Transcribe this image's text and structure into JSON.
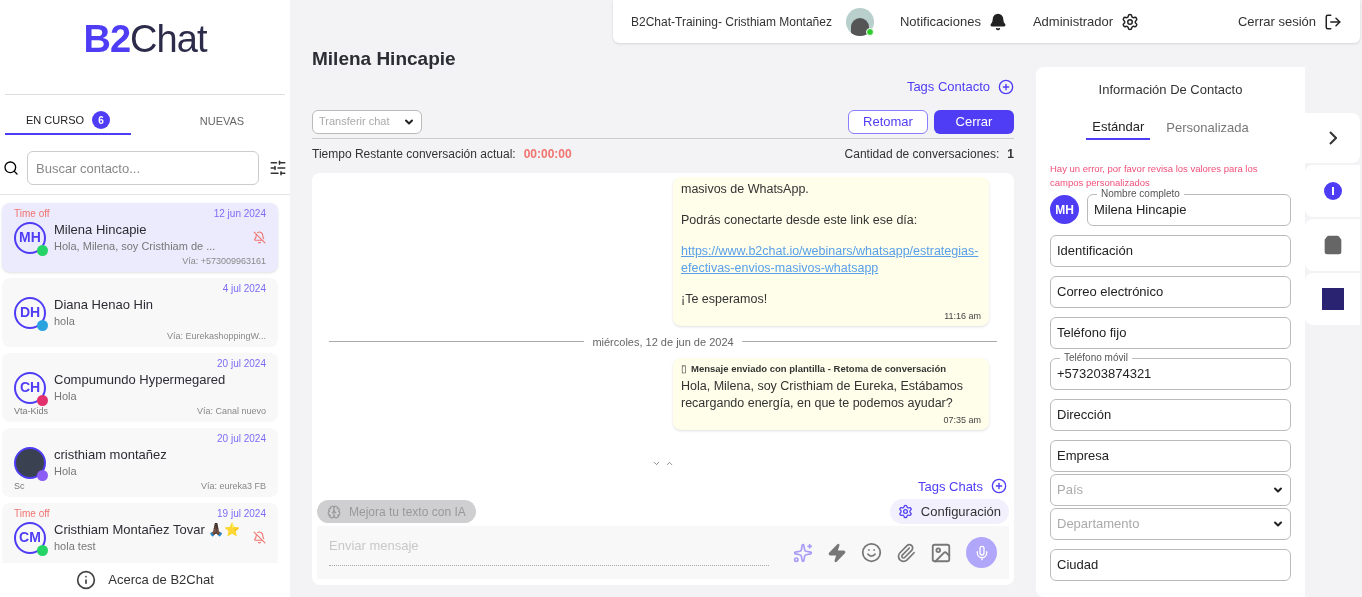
{
  "logo": {
    "mark": "B2",
    "text": "Chat"
  },
  "tabs": [
    {
      "label": "EN CURSO",
      "count": "6",
      "selected": true
    },
    {
      "label": "NUEVAS",
      "selected": false
    }
  ],
  "search": {
    "placeholder": "Buscar contacto..."
  },
  "conversations": [
    {
      "initials": "MH",
      "name": "Milena Hincapie",
      "preview": "Hola,  Milena, soy   Cristhiam de ...",
      "date": "12 jun 2024",
      "via": "Vía: +573009963161",
      "time_off": "Time off",
      "color": "#25d366",
      "muted": true,
      "selected": true
    },
    {
      "initials": "DH",
      "name": "Diana Henao Hin",
      "preview": "hola",
      "date": "4 jul 2024",
      "via": "Vía: EurekashoppingW...",
      "color": "#2aa3df",
      "muted": false,
      "selected": false
    },
    {
      "initials": "CH",
      "name": "Compumundo Hypermegared",
      "preview": "Hola",
      "date": "20 jul 2024",
      "via": "Vía: Canal nuevo",
      "tag": "Vta-Kids",
      "color": "#e1306c",
      "muted": false,
      "selected": false
    },
    {
      "name": "cristhiam montañez",
      "preview": "Hola",
      "date": "20 jul 2024",
      "via": "Vía: eureka3 FB",
      "tag": "Sc",
      "color": "#8b5cf6",
      "muted": false,
      "selected": false
    },
    {
      "initials": "CM",
      "name": "Cristhiam Montañez Tovar 🙏🏿⭐",
      "preview": "hola test",
      "date": "19 jul 2024",
      "time_off": "Time off",
      "color": "#25d366",
      "muted": true,
      "selected": false
    }
  ],
  "about": "Acerca de B2Chat",
  "topbar": {
    "user": "B2Chat-Training- Cristhiam Montañez",
    "online": true,
    "notifications": "Notificaciones",
    "admin": "Administrador",
    "logout": "Cerrar sesión"
  },
  "chat": {
    "title": "Milena Hincapie",
    "tags_contact": "Tags Contacto",
    "transfer_placeholder": "Transferir chat",
    "resume": "Retomar",
    "close": "Cerrar",
    "timer_label": "Tiempo Restante conversación actual:",
    "timer": "00:00:00",
    "count_label": "Cantidad de conversaciones:",
    "count": "1",
    "messages": [
      {
        "kind": "bubble",
        "paragraphs": [
          {
            "text": "masivos de WhatsApp."
          },
          {
            "text": "Podrás conectarte desde este link ese día:"
          },
          {
            "text": "https://www.b2chat.io/webinars/whatsapp/estrategias-efectivas-envios-masivos-whatsapp",
            "link": true
          },
          {
            "text": "¡Te esperamos!"
          }
        ],
        "time": "11:16 am"
      },
      {
        "kind": "divider",
        "text": "miércoles, 12 de jun de 2024"
      },
      {
        "kind": "bubble",
        "header_mark": "▯",
        "header": "Mensaje enviado con plantilla - Retoma de conversación",
        "paragraphs": [
          {
            "text": "Hola,  Milena, soy   Cristhiam de Eureka, Estábamos recargando energía, en que te podemos ayudar?"
          }
        ],
        "time": "07:35 am"
      }
    ],
    "tags_chats": "Tags Chats",
    "ai": {
      "label": "Mejora tu texto con IA",
      "disabled": true
    },
    "settings": "Configuración",
    "composer_placeholder": "Enviar mensaje"
  },
  "contact": {
    "title": "Información De Contacto",
    "tabs": [
      {
        "label": "Estándar",
        "selected": true
      },
      {
        "label": "Personalizada",
        "selected": false
      }
    ],
    "error": "Hay un error, por favor revisa los valores para los campos personalizados",
    "initials": "MH",
    "fields": [
      {
        "kind": "text",
        "label": "Nombre completo",
        "value": "Milena Hincapie"
      },
      {
        "kind": "text",
        "label": "Identificación"
      },
      {
        "kind": "text",
        "label": "Correo electrónico"
      },
      {
        "kind": "text",
        "label": "Teléfono fijo"
      },
      {
        "kind": "text",
        "label": "Teléfono móvil",
        "value": "+573203874321"
      },
      {
        "kind": "text",
        "label": "Dirección"
      },
      {
        "kind": "text",
        "label": "Empresa"
      },
      {
        "kind": "select",
        "placeholder": "País"
      },
      {
        "kind": "select",
        "placeholder": "Departamento"
      },
      {
        "kind": "text",
        "label": "Ciudad"
      }
    ]
  }
}
